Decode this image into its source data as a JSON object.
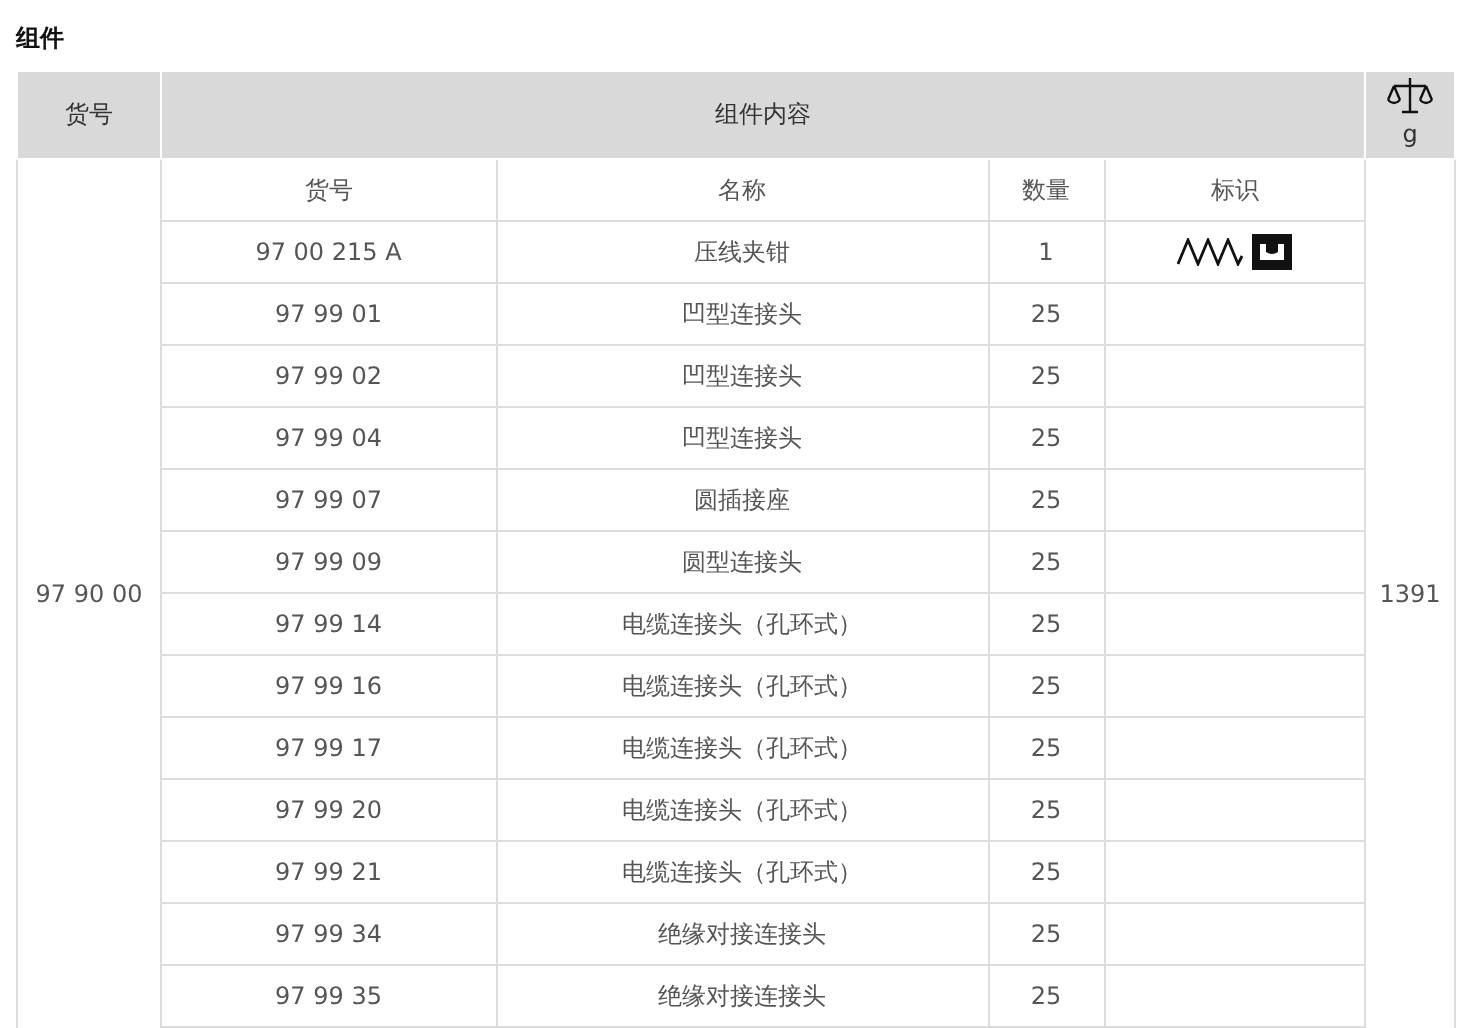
{
  "section_title": "组件",
  "table": {
    "columns": [
      "货号",
      "组件内容",
      "g"
    ],
    "set": {
      "article_no": "97 90 00",
      "weight": "1391",
      "contents": {
        "columns": [
          "货号",
          "名称",
          "数量",
          "标识"
        ],
        "rows": [
          {
            "article_no": "97 00 215 A",
            "name": "压线夹钳",
            "qty": "1",
            "kind": "tool"
          },
          {
            "article_no": "97 99 01",
            "name": "凹型连接头",
            "qty": "25",
            "kind": "part"
          },
          {
            "article_no": "97 99 02",
            "name": "凹型连接头",
            "qty": "25",
            "kind": "part"
          },
          {
            "article_no": "97 99 04",
            "name": "凹型连接头",
            "qty": "25",
            "kind": "part"
          },
          {
            "article_no": "97 99 07",
            "name": "圆插接座",
            "qty": "25",
            "kind": "part"
          },
          {
            "article_no": "97 99 09",
            "name": "圆型连接头",
            "qty": "25",
            "kind": "part"
          },
          {
            "article_no": "97 99 14",
            "name": "电缆连接头（孔环式）",
            "qty": "25",
            "kind": "part"
          },
          {
            "article_no": "97 99 16",
            "name": "电缆连接头（孔环式）",
            "qty": "25",
            "kind": "part"
          },
          {
            "article_no": "97 99 17",
            "name": "电缆连接头（孔环式）",
            "qty": "25",
            "kind": "part"
          },
          {
            "article_no": "97 99 20",
            "name": "电缆连接头（孔环式）",
            "qty": "25",
            "kind": "part"
          },
          {
            "article_no": "97 99 21",
            "name": "电缆连接头（孔环式）",
            "qty": "25",
            "kind": "part"
          },
          {
            "article_no": "97 99 34",
            "name": "绝缘对接连接头",
            "qty": "25",
            "kind": "part"
          },
          {
            "article_no": "97 99 35",
            "name": "绝缘对接连接头",
            "qty": "25",
            "kind": "part"
          }
        ]
      }
    }
  }
}
